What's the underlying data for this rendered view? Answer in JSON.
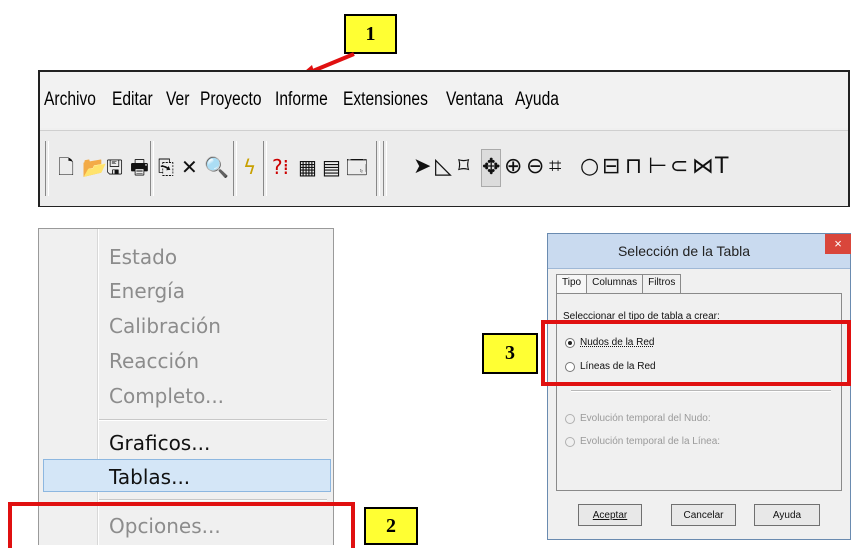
{
  "callouts": [
    "1",
    "2",
    "3"
  ],
  "menubar": {
    "items": [
      "Archivo",
      "Editar",
      "Ver",
      "Proyecto",
      "Informe",
      "Extensiones",
      "Ventana",
      "Ayuda"
    ]
  },
  "toolbar": {
    "icons": [
      "new-file-icon",
      "open-folder-icon",
      "save-icon",
      "print-icon",
      "copy-icon",
      "delete-icon",
      "find-icon",
      "run-icon",
      "query-icon",
      "graph-icon",
      "table-icon",
      "options-icon",
      "select-arrow-icon",
      "select-vertex-icon",
      "select-region-icon",
      "pan-icon",
      "zoom-in-icon",
      "zoom-out-icon",
      "full-extent-icon",
      "junction-icon",
      "reservoir-icon",
      "tank-icon",
      "pipe-icon",
      "pump-icon",
      "valve-icon",
      "label-icon"
    ],
    "glyphs": [
      "🗋",
      "📂",
      "🖫",
      "🖶",
      "⎘",
      "✕",
      "🔍",
      "ϟ",
      "?⁞",
      "▦",
      "▤",
      "🗔",
      "➤",
      "◺",
      "⌑",
      "✥",
      "⊕",
      "⊖",
      "⌗",
      "○",
      "⊟",
      "⊓",
      "⊢",
      "⊂",
      "⋈",
      "T"
    ]
  },
  "report_menu": {
    "items": [
      {
        "label": "Estado",
        "enabled": false
      },
      {
        "label": "Energía",
        "enabled": false
      },
      {
        "label": "Calibración",
        "enabled": false
      },
      {
        "label": "Reacción",
        "enabled": false
      },
      {
        "label": "Completo...",
        "enabled": false
      },
      {
        "label": "Graficos...",
        "enabled": true
      },
      {
        "label": "Tablas...",
        "enabled": true,
        "highlighted": true
      },
      {
        "label": "Opciones...",
        "enabled": false
      }
    ]
  },
  "dialog": {
    "title": "Selección de la Tabla",
    "close": "×",
    "tabs": [
      "Tipo",
      "Columnas",
      "Filtros"
    ],
    "prompt": "Seleccionar el tipo de tabla a crear:",
    "options": [
      {
        "label": "Nudos de la Red",
        "checked": true,
        "enabled": true
      },
      {
        "label": "Líneas de la Red",
        "checked": false,
        "enabled": true
      },
      {
        "label": "Evolución temporal del Nudo:",
        "checked": false,
        "enabled": false
      },
      {
        "label": "Evolución temporal de la Línea:",
        "checked": false,
        "enabled": false
      }
    ],
    "buttons": {
      "ok": "Aceptar",
      "cancel": "Cancelar",
      "help": "Ayuda"
    }
  },
  "colors": {
    "callout_bg": "#ffff33",
    "highlight_box": "#e01010",
    "arrow": "#e01010",
    "menu_highlight": "#d4e6f7"
  }
}
